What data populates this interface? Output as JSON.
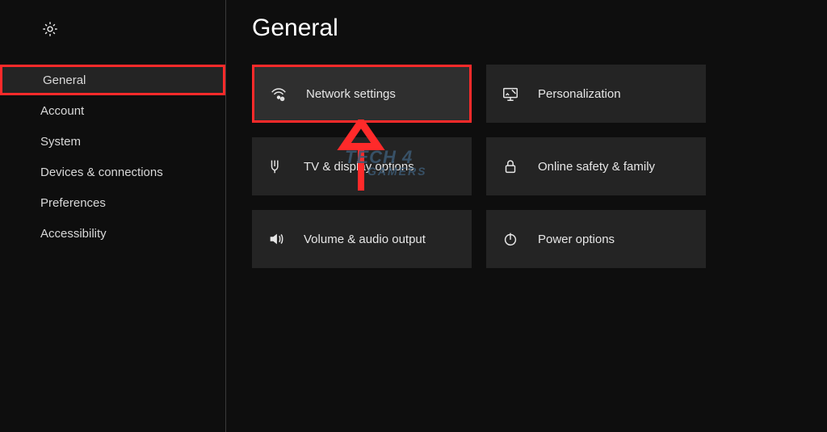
{
  "header": {
    "title": "General"
  },
  "sidebar": {
    "items": [
      {
        "label": "General",
        "active": true,
        "highlighted": true
      },
      {
        "label": "Account",
        "active": false,
        "highlighted": false
      },
      {
        "label": "System",
        "active": false,
        "highlighted": false
      },
      {
        "label": "Devices & connections",
        "active": false,
        "highlighted": false
      },
      {
        "label": "Preferences",
        "active": false,
        "highlighted": false
      },
      {
        "label": "Accessibility",
        "active": false,
        "highlighted": false
      }
    ]
  },
  "tiles": [
    {
      "icon": "network-icon",
      "label": "Network settings",
      "highlighted": true
    },
    {
      "icon": "personalization-icon",
      "label": "Personalization",
      "highlighted": false
    },
    {
      "icon": "tv-display-icon",
      "label": "TV & display options",
      "highlighted": false
    },
    {
      "icon": "lock-icon",
      "label": "Online safety & family",
      "highlighted": false
    },
    {
      "icon": "volume-icon",
      "label": "Volume & audio output",
      "highlighted": false
    },
    {
      "icon": "power-icon",
      "label": "Power options",
      "highlighted": false
    }
  ],
  "watermark": {
    "line1": "TECH 4",
    "line2": "GAMERS"
  }
}
